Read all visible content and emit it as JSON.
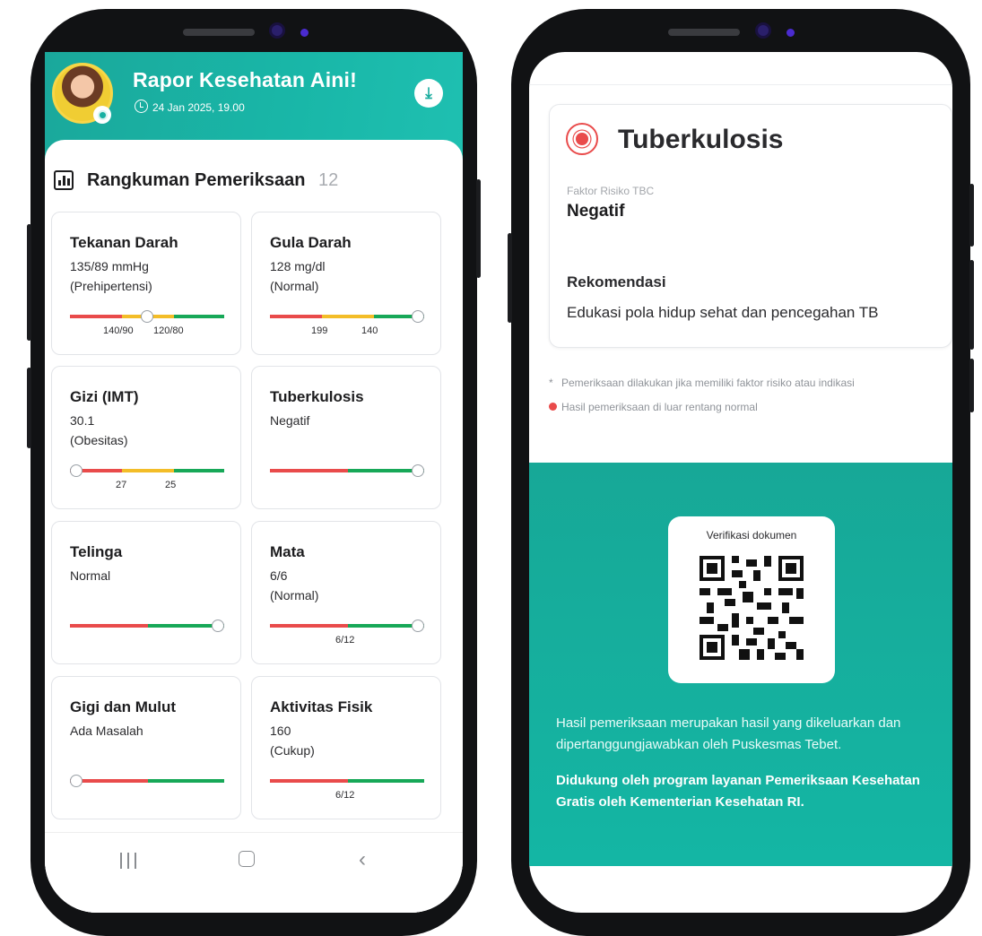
{
  "left_phone": {
    "header": {
      "title": "Rapor Kesehatan Aini!",
      "datetime": "24 Jan 2025, 19.00",
      "download_icon": "download-icon",
      "download_symbol": "⤓"
    },
    "summary": {
      "title": "Rangkuman Pemeriksaan",
      "count": "12"
    },
    "cards": [
      {
        "title": "Tekanan Darah",
        "line1": "135/89 mmHg",
        "line2": "(Prehipertensi)",
        "ticks": [
          "140/90",
          "120/80"
        ],
        "level": "yellow-green boundary"
      },
      {
        "title": "Gula Darah",
        "line1": "128 mg/dl",
        "line2": "(Normal)",
        "ticks": [
          "199",
          "140"
        ],
        "level": "green end"
      },
      {
        "title": "Gizi (IMT)",
        "line1": "30.1",
        "line2": "(Obesitas)",
        "ticks": [
          "27",
          "25"
        ],
        "level": "red start"
      },
      {
        "title": "Tuberkulosis",
        "line1": "Negatif",
        "line2": "",
        "ticks": [],
        "level": "green end"
      },
      {
        "title": "Telinga",
        "line1": "Normal",
        "line2": "",
        "ticks": [],
        "level": "green end"
      },
      {
        "title": "Mata",
        "line1": "6/6",
        "line2": "(Normal)",
        "ticks": [
          "6/12"
        ],
        "level": "green end"
      },
      {
        "title": "Gigi dan Mulut",
        "line1": "Ada Masalah",
        "line2": "",
        "ticks": [],
        "level": "red start"
      },
      {
        "title": "Aktivitas Fisik",
        "line1": "160",
        "line2": "(Cukup)",
        "ticks": [
          "6/12"
        ],
        "level": "none"
      }
    ],
    "navbar": {
      "back_symbol": "‹"
    },
    "colors": {
      "teal": "#19b0a2",
      "red": "#e94b4b",
      "yellow": "#f3bd28",
      "green": "#17a858"
    }
  },
  "right_phone": {
    "tb_card": {
      "title": "Tuberkulosis",
      "factor_label": "Faktor Risiko TBC",
      "factor_value": "Negatif",
      "recommendation_label": "Rekomendasi",
      "recommendation_value": "Edukasi pola hidup sehat dan pencegahan TB"
    },
    "notes": {
      "star_symbol": "*",
      "star_note": "Pemeriksaan dilakukan jika memiliki faktor risiko atau indikasi",
      "dot_note": "Hasil pemeriksaan di luar rentang normal"
    },
    "verification": {
      "label": "Verifikasi dokumen",
      "qr_icon": "qr-code-icon"
    },
    "footer": {
      "text1": "Hasil pemeriksaan merupakan hasil yang dikeluarkan dan dipertanggungjawabkan oleh Puskesmas Tebet.",
      "text2": "Didukung oleh program layanan Pemeriksaan Kesehatan Gratis oleh Kementerian Kesehatan RI."
    }
  }
}
